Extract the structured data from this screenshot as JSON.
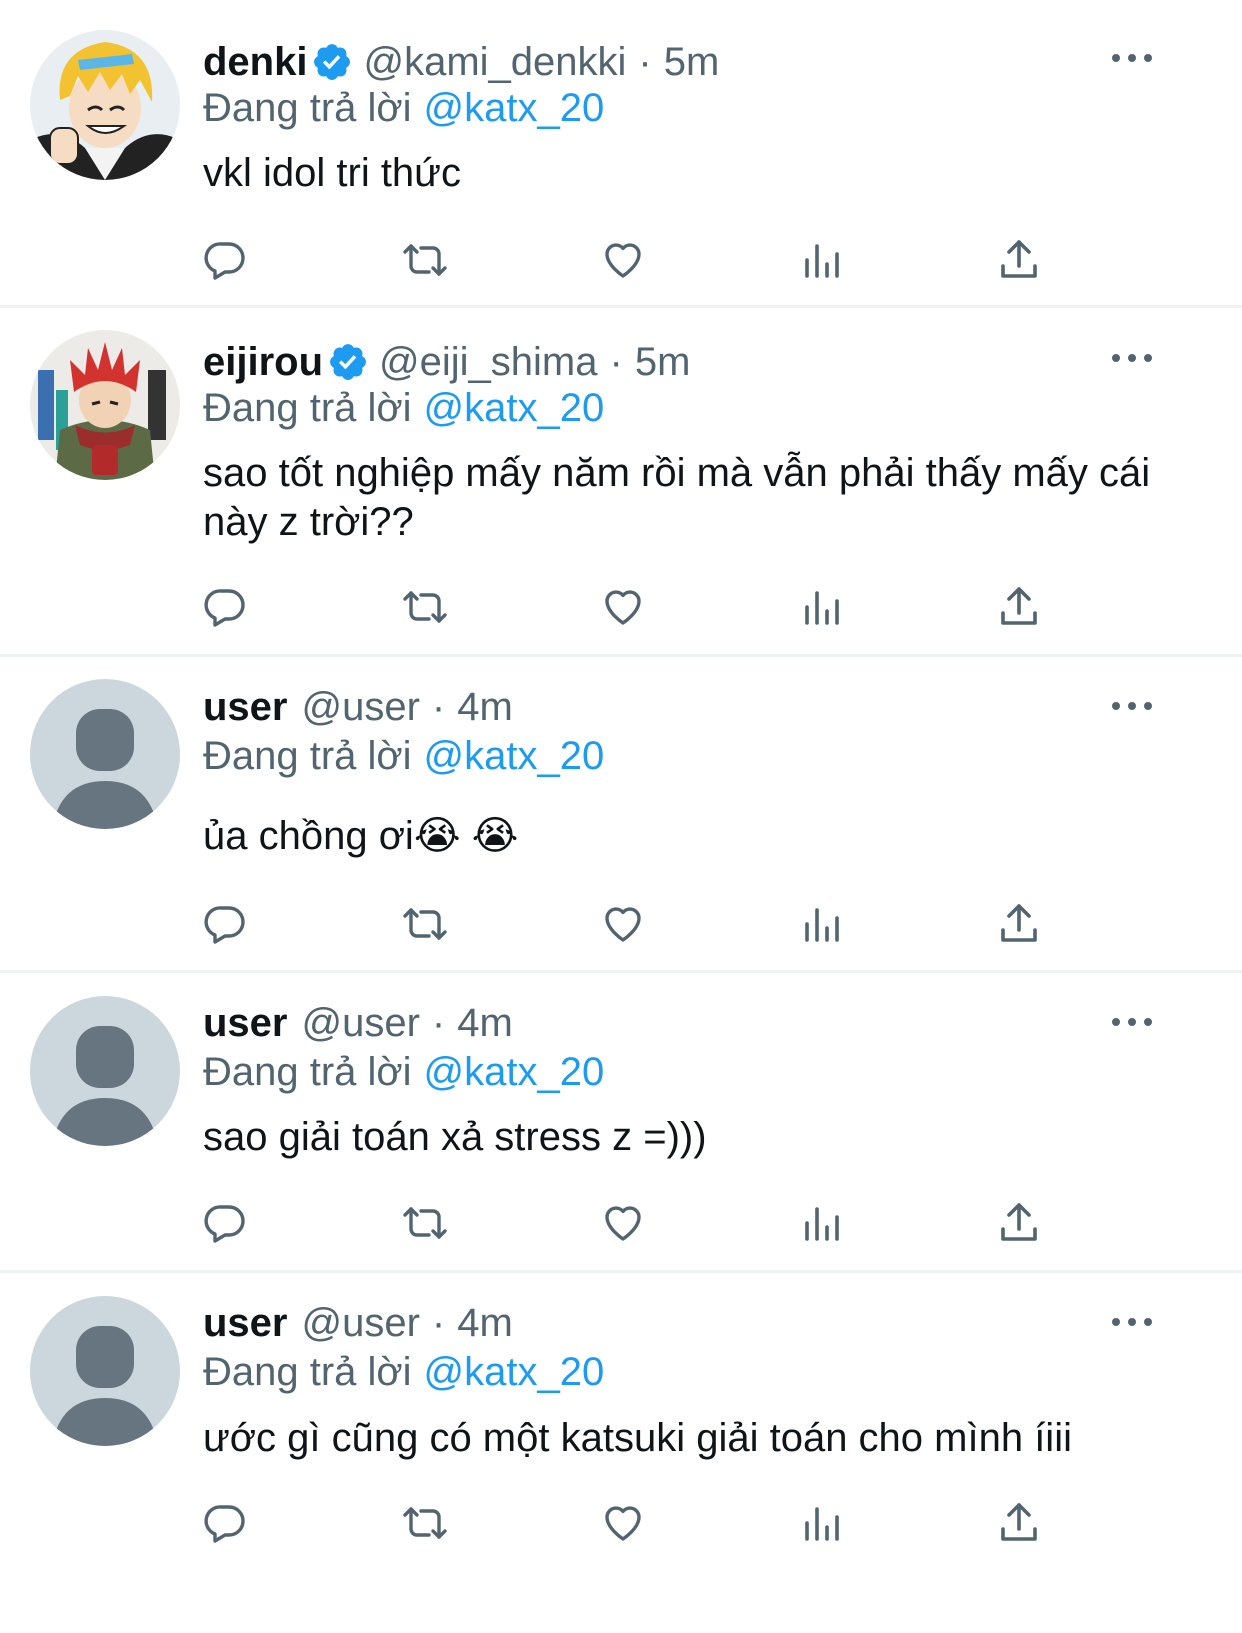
{
  "tweets": [
    {
      "name": "denki",
      "verified": true,
      "handle": "@kami_denkki",
      "dot": "·",
      "time": "5m",
      "replying_label": "Đang trả lời",
      "replying_to": "@katx_20",
      "text": "vkl idol tri thức",
      "avatar": "anime-avatar-yellow-hair"
    },
    {
      "name": "eijirou",
      "verified": true,
      "handle": "@eiji_shima",
      "dot": "·",
      "time": "5m",
      "replying_label": "Đang trả lời",
      "replying_to": "@katx_20",
      "text": "sao tốt nghiệp mấy năm rồi mà vẫn phải thấy mấy cái này z trời??",
      "avatar": "anime-avatar-red-hair"
    },
    {
      "name": "user",
      "verified": false,
      "handle": "@user",
      "dot": "·",
      "time": "4m",
      "replying_label": "Đang trả lời",
      "replying_to": "@katx_20",
      "text": "ủa chồng ơi😭 😭",
      "avatar": "default-avatar"
    },
    {
      "name": "user",
      "verified": false,
      "handle": "@user",
      "dot": "·",
      "time": "4m",
      "replying_label": "Đang trả lời",
      "replying_to": "@katx_20",
      "text": "sao giải toán xả stress z =)))",
      "avatar": "default-avatar"
    },
    {
      "name": "user",
      "verified": false,
      "handle": "@user",
      "dot": "·",
      "time": "4m",
      "replying_label": "Đang trả lời",
      "replying_to": "@katx_20",
      "text": "ước gì cũng có một katsuki giải toán cho mình íiii",
      "avatar": "default-avatar"
    }
  ],
  "icons": [
    "reply-icon",
    "retweet-icon",
    "like-icon",
    "views-icon",
    "share-icon",
    "more-icon",
    "verified-icon"
  ],
  "colors": {
    "accent": "#1d9bf0",
    "muted": "#536471",
    "text": "#0f1419",
    "divider": "#eff3f4",
    "avatar_bg": "#ccd6dd",
    "avatar_fg": "#66757f"
  }
}
